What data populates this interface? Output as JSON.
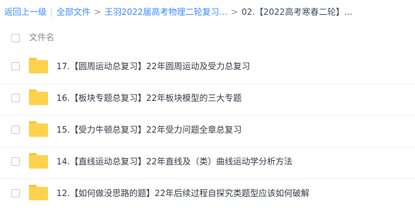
{
  "breadcrumb": {
    "back": "返回上一级",
    "separator": "|",
    "items": [
      {
        "label": "全部文件"
      },
      {
        "label": "王羽2022届高考物理二轮复习..."
      },
      {
        "label": "02.【2022高考寒春二轮】..."
      }
    ],
    "arrow": ">"
  },
  "list": {
    "column_label": "文件名",
    "items": [
      {
        "name": "17.【圆周运动总复习】22年圆周运动及受力总复习",
        "icon": "folder-icon"
      },
      {
        "name": "16.【板块专题总复习】22年板块模型的三大专题",
        "icon": "folder-icon"
      },
      {
        "name": "15.【受力牛顿总复习】22年受力问题全章总复习",
        "icon": "folder-icon"
      },
      {
        "name": "14.【直线运动总复习】22年直线及（类）曲线运动学分析方法",
        "icon": "folder-icon"
      },
      {
        "name": "12.【如何做没思路的题】22年后续过程自探究类题型应该如何破解",
        "icon": "folder-icon"
      }
    ]
  },
  "colors": {
    "link": "#3b8cff",
    "folder": "#ffd24d",
    "text": "#333a47"
  }
}
